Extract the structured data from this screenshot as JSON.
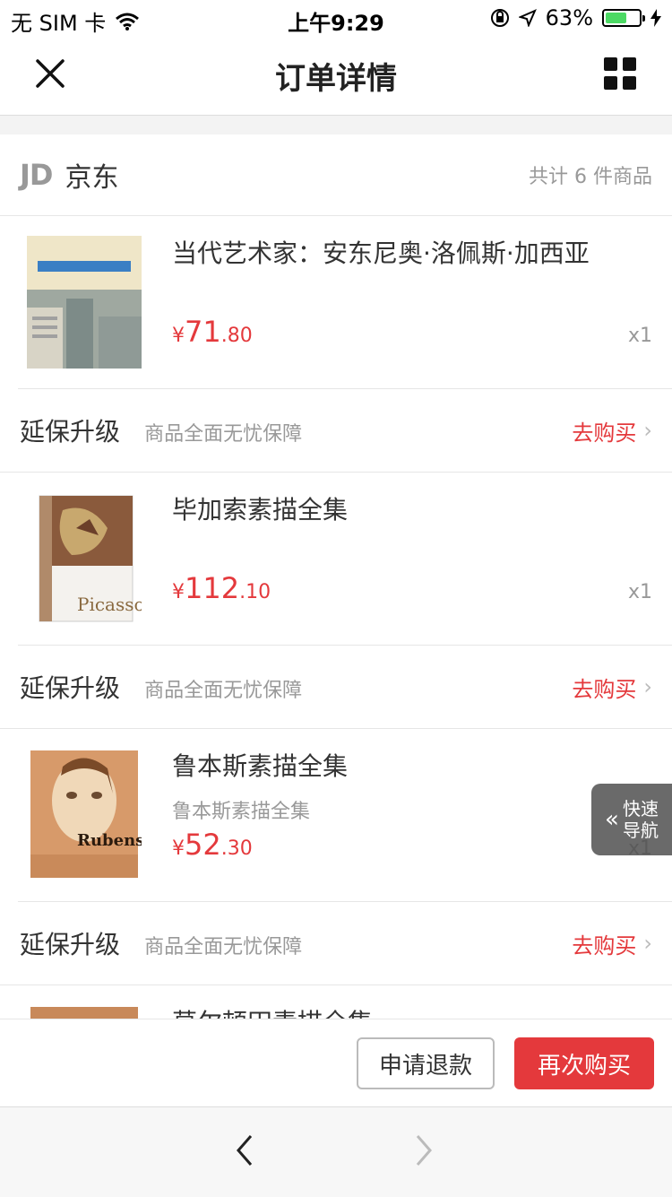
{
  "status": {
    "carrier": "无 SIM 卡",
    "time": "上午9:29",
    "battery": "63%",
    "battery_level": 0.63
  },
  "nav": {
    "title": "订单详情",
    "close_icon": "close-icon",
    "menu_icon": "grid-icon"
  },
  "store": {
    "logo": "JD",
    "name": "京东",
    "count": "共计 6 件商品"
  },
  "items": [
    {
      "name": "当代艺术家：安东尼奥·洛佩斯·加西亚",
      "sub": "",
      "price_cur": "¥",
      "price_int": "71",
      "price_dec": ".80",
      "qty": "x1"
    },
    {
      "name": "毕加索素描全集",
      "sub": "",
      "price_cur": "¥",
      "price_int": "112",
      "price_dec": ".10",
      "qty": "x1"
    },
    {
      "name": "鲁本斯素描全集",
      "sub": "鲁本斯素描全集",
      "price_cur": "¥",
      "price_int": "52",
      "price_dec": ".30",
      "qty": "x1"
    },
    {
      "name": "莫尔顿田素描全集"
    }
  ],
  "warranty": {
    "label": "延保升级",
    "desc": "商品全面无忧保障",
    "action": "去购买"
  },
  "quicknav": {
    "line1": "快速",
    "line2": "导航"
  },
  "actions": {
    "refund": "申请退款",
    "rebuy": "再次购买"
  },
  "colors": {
    "accent": "#e4393c",
    "muted": "#999999"
  }
}
